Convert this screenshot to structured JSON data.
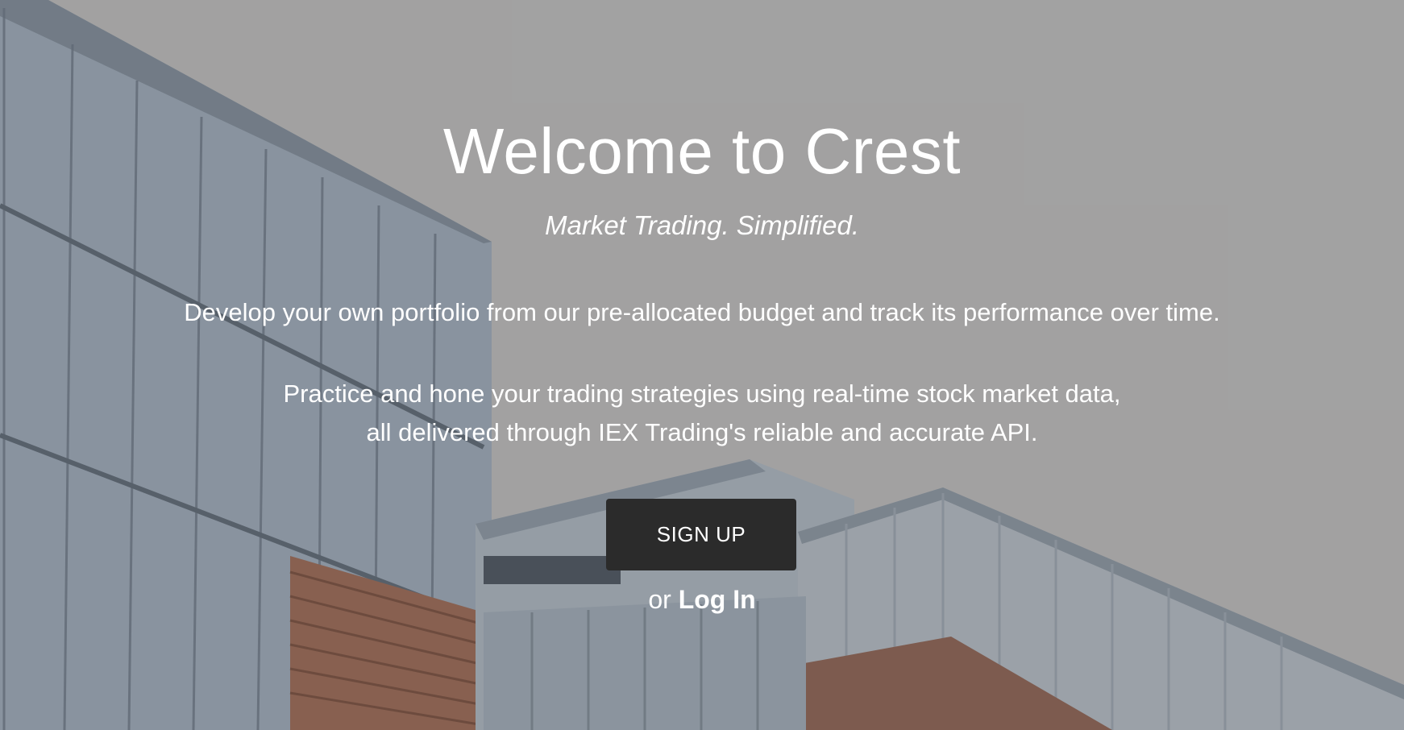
{
  "hero": {
    "title": "Welcome to Crest",
    "tagline": "Market Trading. Simplified.",
    "description_1": "Develop your own portfolio from our pre-allocated budget and track its performance over time.",
    "description_2_line_1": "Practice and hone your trading strategies using real-time stock market data,",
    "description_2_line_2": "all delivered through IEX Trading's reliable and accurate API.",
    "signup_label": "SIGN UP",
    "login_prefix": "or",
    "login_label": "Log In"
  },
  "colors": {
    "text": "#ffffff",
    "button_bg": "#2b2b2b",
    "sky": "#a9a8a8"
  }
}
